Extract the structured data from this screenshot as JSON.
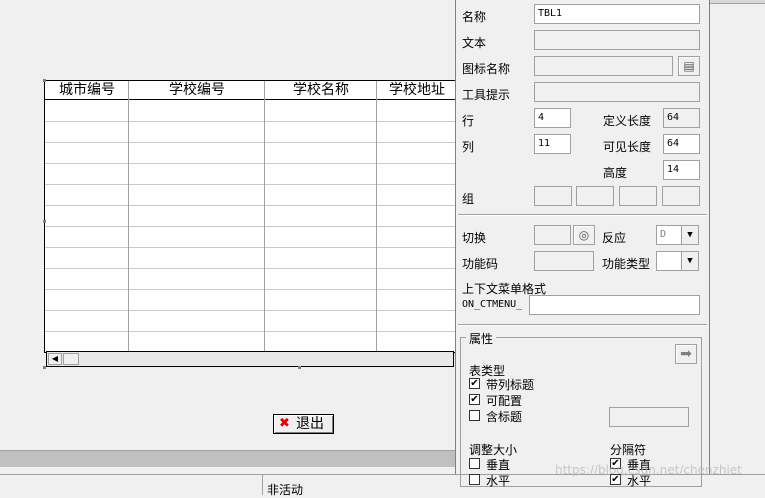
{
  "table": {
    "headers": [
      "城市编号",
      "学校编号",
      "学校名称",
      "学校地址"
    ],
    "row_count": 12
  },
  "exit_button": {
    "label": "退出",
    "icon": "close-icon"
  },
  "status": {
    "text": "非活动"
  },
  "props": {
    "name_label": "名称",
    "name_value": "TBL1",
    "text_label": "文本",
    "text_value": "",
    "icon_label": "图标名称",
    "icon_value": "",
    "tooltip_label": "工具提示",
    "tooltip_value": "",
    "rows_label": "行",
    "rows_value": "4",
    "cols_label": "列",
    "cols_value": "11",
    "deflen_label": "定义长度",
    "deflen_value": "64",
    "vislen_label": "可见长度",
    "vislen_value": "64",
    "height_label": "高度",
    "height_value": "14",
    "group_label": "组",
    "toggle_label": "切换",
    "reaction_label": "反应",
    "reaction_value": "D",
    "funccode_label": "功能码",
    "functype_label": "功能类型",
    "ctxmenu_label": "上下文菜单格式",
    "ctxmenu_prefix": "ON_CTMENU_",
    "attr_title": "属性",
    "tabletype_label": "表类型",
    "col_title_label": "带列标题",
    "col_title_checked": true,
    "configurable_label": "可配置",
    "configurable_checked": true,
    "with_title_label": "含标题",
    "with_title_checked": false,
    "resize_label": "调整大小",
    "resize_vertical_label": "垂直",
    "resize_vertical_checked": false,
    "resize_horizontal_label": "水平",
    "resize_horizontal_checked": false,
    "separator_label": "分隔符",
    "sep_vertical_label": "垂直",
    "sep_vertical_checked": true,
    "sep_horizontal_label": "水平",
    "sep_horizontal_checked": true
  },
  "watermark": "https://blog.csdn.net/chenzhiet"
}
